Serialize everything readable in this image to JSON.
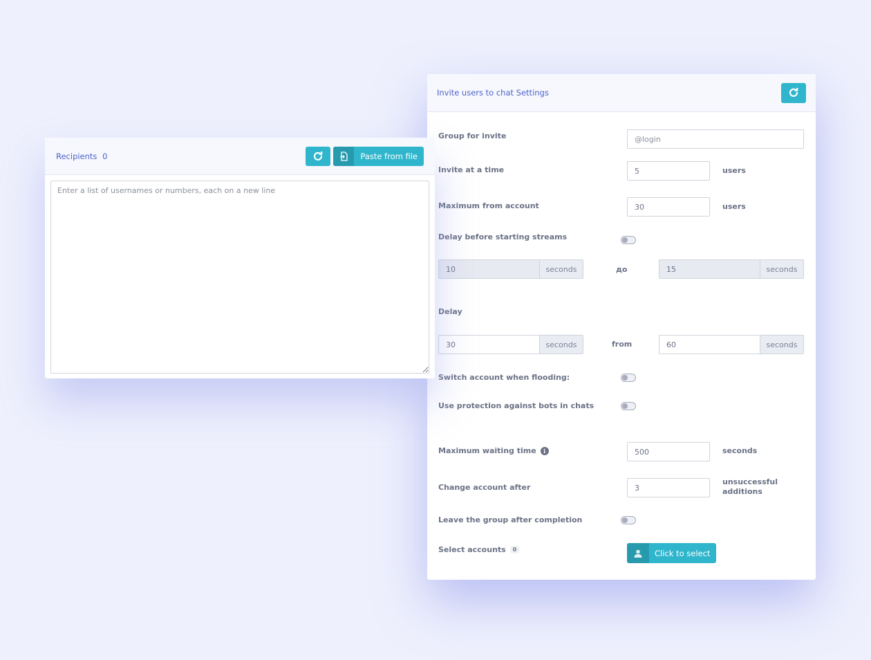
{
  "recipients": {
    "title": "Recipients",
    "count": "0",
    "paste_label": "Paste from file",
    "placeholder": "Enter a list of usernames or numbers, each on a new line",
    "value": ""
  },
  "settings": {
    "title": "Invite users to chat Settings",
    "group_for_invite": {
      "label": "Group for invite",
      "placeholder": "@login",
      "value": ""
    },
    "invite_at_a_time": {
      "label": "Invite at a time",
      "value": "5",
      "unit": "users"
    },
    "maximum_from_account": {
      "label": "Maximum from account",
      "value": "30",
      "unit": "users"
    },
    "delay_before_streams": {
      "label": "Delay before starting streams",
      "enabled": false,
      "from_value": "10",
      "from_unit": "seconds",
      "separator": "до",
      "to_value": "15",
      "to_unit": "seconds"
    },
    "delay": {
      "label": "Delay",
      "from_value": "30",
      "from_unit": "seconds",
      "separator": "from",
      "to_value": "60",
      "to_unit": "seconds"
    },
    "switch_account_flooding": {
      "label": "Switch account when flooding:",
      "enabled": false
    },
    "bot_protection": {
      "label": "Use protection against bots in chats",
      "enabled": false
    },
    "maximum_waiting_time": {
      "label": "Maximum waiting time",
      "info_icon": "info-icon",
      "value": "500",
      "unit": "seconds"
    },
    "change_account_after": {
      "label": "Change account after",
      "value": "3",
      "unit_line1": "unsuccessful",
      "unit_line2": "additions"
    },
    "leave_group": {
      "label": "Leave the group after completion",
      "enabled": false
    },
    "select_accounts": {
      "label": "Select accounts",
      "count": "0",
      "button_label": "Click to select"
    }
  },
  "colors": {
    "accent": "#30b6cc",
    "accent_dark": "#279aae",
    "title": "#4f63c9",
    "background": "#eef0fd"
  }
}
